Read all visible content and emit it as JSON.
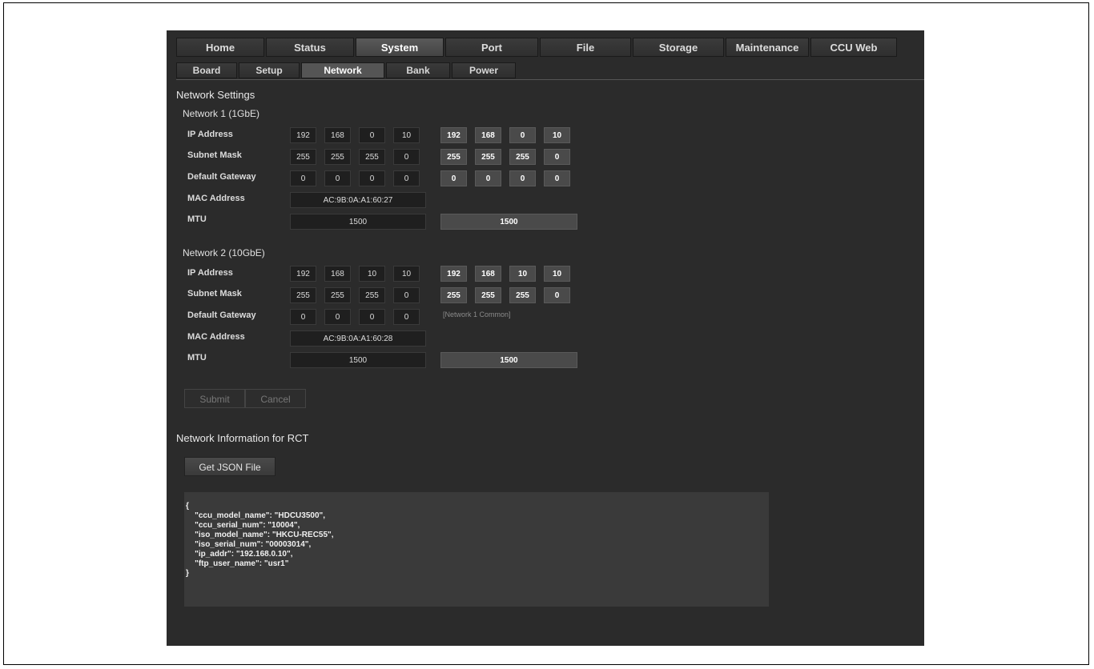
{
  "main_tabs": [
    {
      "label": "Home",
      "active": false
    },
    {
      "label": "Status",
      "active": false
    },
    {
      "label": "System",
      "active": true
    },
    {
      "label": "Port",
      "active": false
    },
    {
      "label": "File",
      "active": false
    },
    {
      "label": "Storage",
      "active": false
    },
    {
      "label": "Maintenance",
      "active": false
    },
    {
      "label": "CCU Web",
      "active": false
    }
  ],
  "sub_tabs": [
    {
      "label": "Board",
      "active": false
    },
    {
      "label": "Setup",
      "active": false
    },
    {
      "label": "Network",
      "active": true
    },
    {
      "label": "Bank",
      "active": false
    },
    {
      "label": "Power",
      "active": false
    }
  ],
  "section_title": "Network Settings",
  "network1": {
    "title": "Network 1 (1GbE)",
    "labels": {
      "ip": "IP Address",
      "subnet": "Subnet Mask",
      "gateway": "Default Gateway",
      "mac": "MAC Address",
      "mtu": "MTU"
    },
    "ip_current": [
      "192",
      "168",
      "0",
      "10"
    ],
    "ip_new": [
      "192",
      "168",
      "0",
      "10"
    ],
    "subnet_current": [
      "255",
      "255",
      "255",
      "0"
    ],
    "subnet_new": [
      "255",
      "255",
      "255",
      "0"
    ],
    "gateway_current": [
      "0",
      "0",
      "0",
      "0"
    ],
    "gateway_new": [
      "0",
      "0",
      "0",
      "0"
    ],
    "mac": "AC:9B:0A:A1:60:27",
    "mtu_current": "1500",
    "mtu_new": "1500"
  },
  "network2": {
    "title": "Network 2 (10GbE)",
    "labels": {
      "ip": "IP Address",
      "subnet": "Subnet Mask",
      "gateway": "Default Gateway",
      "mac": "MAC Address",
      "mtu": "MTU"
    },
    "ip_current": [
      "192",
      "168",
      "10",
      "10"
    ],
    "ip_new": [
      "192",
      "168",
      "10",
      "10"
    ],
    "subnet_current": [
      "255",
      "255",
      "255",
      "0"
    ],
    "subnet_new": [
      "255",
      "255",
      "255",
      "0"
    ],
    "gateway_current": [
      "0",
      "0",
      "0",
      "0"
    ],
    "gateway_note": "[Network 1 Common]",
    "mac": "AC:9B:0A:A1:60:28",
    "mtu_current": "1500",
    "mtu_new": "1500"
  },
  "buttons": {
    "submit": "Submit",
    "cancel": "Cancel",
    "get_json": "Get JSON File"
  },
  "rct": {
    "title": "Network Information for RCT",
    "json_lines": [
      "{",
      "    \"ccu_model_name\": \"HDCU3500\",",
      "    \"ccu_serial_num\": \"10004\",",
      "    \"iso_model_name\": \"HKCU-REC55\",",
      "    \"iso_serial_num\": \"00003014\",",
      "    \"ip_addr\": \"192.168.0.10\",",
      "    \"ftp_user_name\": \"usr1\"",
      "}"
    ]
  }
}
